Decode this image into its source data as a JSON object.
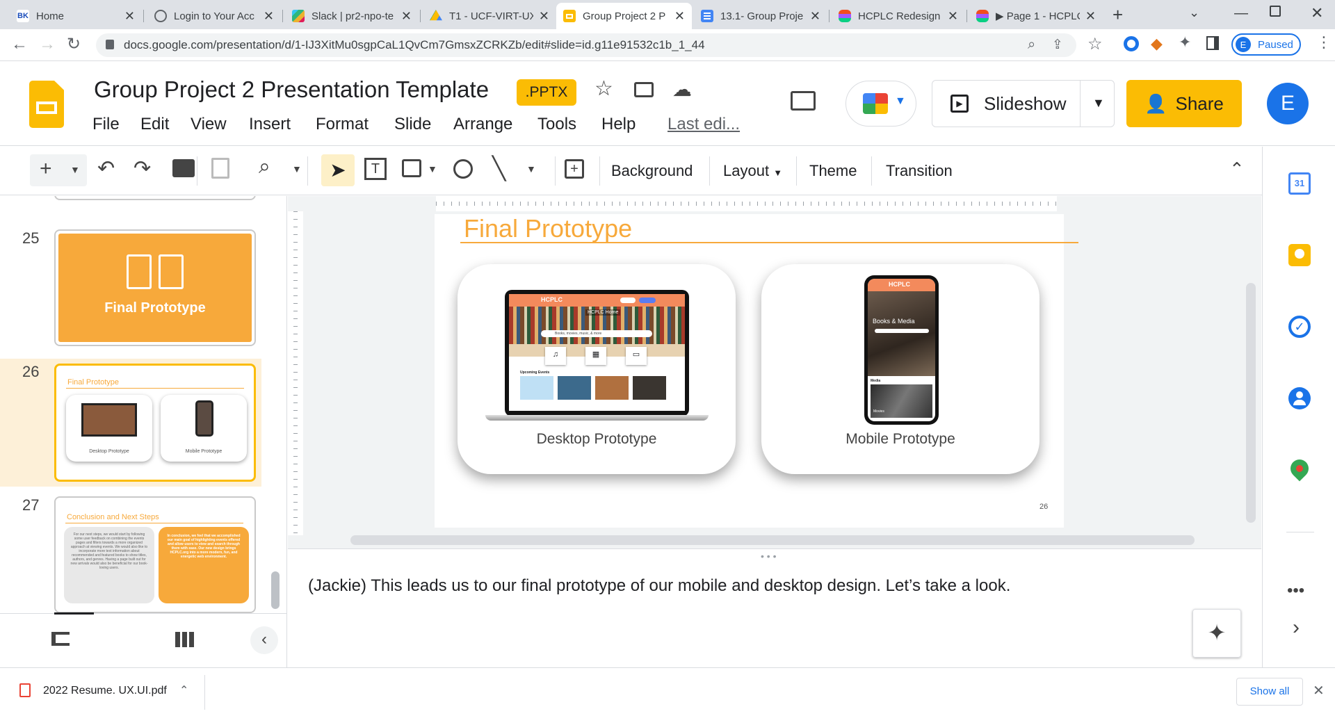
{
  "browser": {
    "tabs": [
      {
        "title": "Home",
        "icon": "bk-icon",
        "color": "#1a73e8"
      },
      {
        "title": "Login to Your Acc",
        "icon": "globe-icon",
        "color": "#5f6368"
      },
      {
        "title": "Slack | pr2-npo-te",
        "icon": "slack-icon",
        "color": "#e01e5a"
      },
      {
        "title": "T1 - UCF-VIRT-UX",
        "icon": "drive-icon",
        "color": "#0f9d58"
      },
      {
        "title": "Group Project 2 P",
        "icon": "slides-icon",
        "color": "#fbbc04"
      },
      {
        "title": "13.1- Group Proje",
        "icon": "docs-icon",
        "color": "#4285f4"
      },
      {
        "title": "HCPLC Redesign",
        "icon": "figma-icon",
        "color": "#f24e1e"
      },
      {
        "title": "▶ Page 1 - HCPLC",
        "icon": "figma-icon",
        "color": "#f24e1e"
      }
    ],
    "url": "docs.google.com/presentation/d/1-IJ3XitMu0sgpCaL1QvCm7GmsxZCRKZb/edit#slide=id.g11e91532c1b_1_44",
    "profile_letter": "E",
    "profile_status": "Paused"
  },
  "doc": {
    "title": "Group Project 2 Presentation Template",
    "format_badge": ".PPTX",
    "menus": [
      "File",
      "Edit",
      "View",
      "Insert",
      "Format",
      "Slide",
      "Arrange",
      "Tools",
      "Help"
    ],
    "last_edit": "Last edi...",
    "slideshow_label": "Slideshow",
    "share_label": "Share",
    "avatar_letter": "E"
  },
  "toolbar": {
    "background": "Background",
    "layout": "Layout",
    "theme": "Theme",
    "transition": "Transition"
  },
  "filmstrip": {
    "slides": [
      {
        "number": "25",
        "title": "Final Prototype"
      },
      {
        "number": "26",
        "title": "Final Prototype",
        "left": "Desktop Prototype",
        "right": "Mobile Prototype"
      },
      {
        "number": "27",
        "title": "Conclusion and Next Steps",
        "left_text": "For our next steps, we would start by following some user feedback on combining the events pages and filters towards a more organized approach at viewing events. We would also like to incorporate more text information about recommended and featured books to show titles, authors, and genres. Having a page built out for new arrivals would also be beneficial for our book-loving users.",
        "right_text": "In conclusion, we feel that we accomplished our main goal of highlighting events offered and allow users to view and search through them with ease. Our new design brings HCPLC.org into a more modern, fun, and energetic web environment."
      }
    ]
  },
  "slide": {
    "title": "Final Prototype",
    "left_caption": "Desktop Prototype",
    "right_caption": "Mobile Prototype",
    "page_number": "26",
    "desktop_logo": "HCPLC",
    "desktop_heading": "HCPLC Home",
    "desktop_search": "Books, movies, music, & more",
    "desktop_events": "Upcoming Events",
    "mobile_logo": "HCPLC",
    "mobile_heading": "Books & Media",
    "mobile_section": "Media",
    "mobile_card": "Movies",
    "accent_color": "#f7a93b"
  },
  "speaker_notes": "(Jackie) This leads us to our final prototype of our mobile and desktop design. Let’s take a look.",
  "downloads": {
    "file": "2022 Resume. UX.UI.pdf",
    "show_all": "Show all"
  }
}
